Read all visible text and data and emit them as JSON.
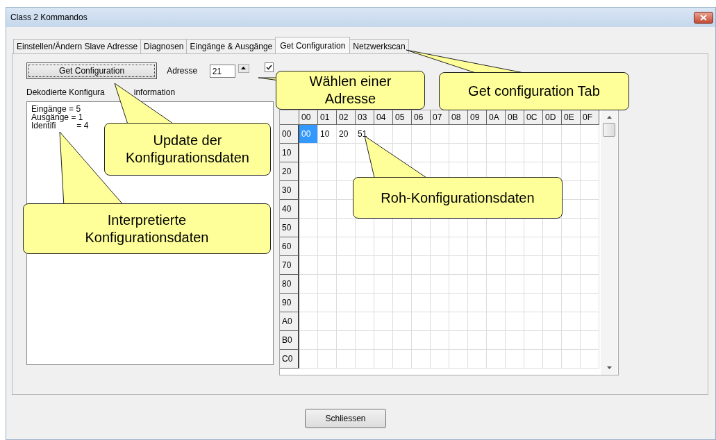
{
  "window": {
    "title": "Class 2 Kommandos"
  },
  "tabs": [
    {
      "label": "Einstellen/Ändern Slave Adresse",
      "selected": false
    },
    {
      "label": "Diagnosen",
      "selected": false
    },
    {
      "label": "Eingänge & Ausgänge",
      "selected": false
    },
    {
      "label": "Get Configuration",
      "selected": true
    },
    {
      "label": "Netzwerkscan",
      "selected": false
    }
  ],
  "get_button": "Get Configuration",
  "address": {
    "label": "Adresse",
    "value": "21"
  },
  "update_checkbox": {
    "checked": true
  },
  "decoded_label": [
    "Dekodierte Konfigura",
    "information"
  ],
  "decoded_lines": [
    [
      "Eingänge = 5"
    ],
    [
      "Ausgänge = 1"
    ],
    [
      "Identifi",
      "= 4"
    ]
  ],
  "grid": {
    "columns": [
      "00",
      "01",
      "02",
      "03",
      "04",
      "05",
      "06",
      "07",
      "08",
      "09",
      "0A",
      "0B",
      "0C",
      "0D",
      "0E",
      "0F"
    ],
    "rows": [
      {
        "label": "00",
        "cells": [
          {
            "value": "00",
            "selected": true
          },
          {
            "value": "10",
            "selected": false
          },
          {
            "value": "20",
            "selected": false
          },
          {
            "value": "51",
            "selected": false
          }
        ]
      },
      {
        "label": "10",
        "cells": []
      },
      {
        "label": "20",
        "cells": []
      },
      {
        "label": "30",
        "cells": []
      },
      {
        "label": "40",
        "cells": []
      },
      {
        "label": "50",
        "cells": []
      },
      {
        "label": "60",
        "cells": []
      },
      {
        "label": "70",
        "cells": []
      },
      {
        "label": "80",
        "cells": []
      },
      {
        "label": "90",
        "cells": []
      },
      {
        "label": "A0",
        "cells": []
      },
      {
        "label": "B0",
        "cells": []
      },
      {
        "label": "C0",
        "cells": []
      }
    ]
  },
  "close_button": "Schliessen",
  "callouts": [
    {
      "lines": [
        "Wählen einer",
        "Adresse"
      ]
    },
    {
      "lines": [
        "Get configuration Tab"
      ]
    },
    {
      "lines": [
        "Update der",
        "Konfigurationsdaten"
      ]
    },
    {
      "lines": [
        "Interpretierte",
        "Konfigurationsdaten"
      ]
    },
    {
      "lines": [
        "Roh-Konfigurationsdaten"
      ]
    }
  ]
}
